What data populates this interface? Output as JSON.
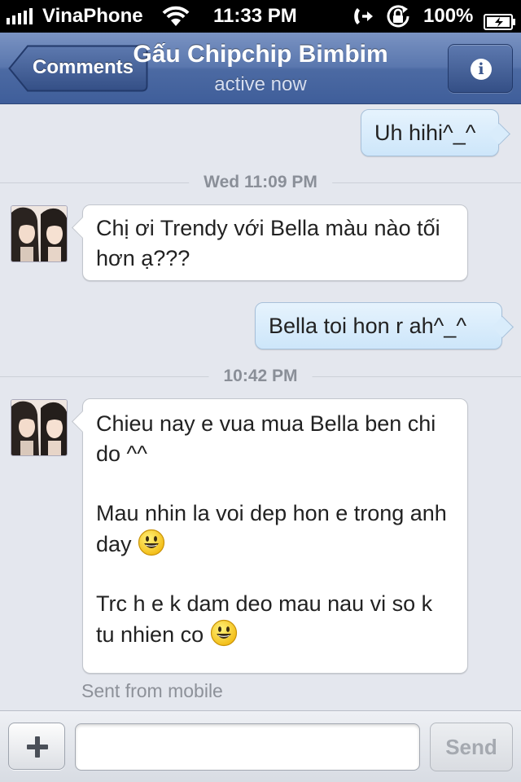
{
  "status_bar": {
    "carrier": "VinaPhone",
    "time": "11:33 PM",
    "battery_percent": "100%",
    "icons": [
      "signal-icon",
      "wifi-icon",
      "call-forwarding-icon",
      "rotation-lock-icon",
      "battery-icon"
    ]
  },
  "nav": {
    "back_label": "Comments",
    "title": "Gấu Chipchip Bimbim",
    "subtitle": "active now",
    "info_icon": "info-icon",
    "info_glyph": "i",
    "colors": {
      "bar": "#4c6aa3",
      "text": "#ffffff"
    }
  },
  "messages": [
    {
      "direction": "outgoing",
      "text": "Uh hihi^_^"
    },
    {
      "type": "timestamp",
      "text": "Wed 11:09 PM"
    },
    {
      "direction": "incoming",
      "lines": [
        "Chị ơi Trendy với Bella màu nào tối hơn ạ???"
      ]
    },
    {
      "direction": "outgoing",
      "text": "Bella toi hon r ah^_^"
    },
    {
      "type": "timestamp",
      "text": "10:42 PM"
    },
    {
      "direction": "incoming",
      "paragraphs": [
        "Chieu nay e vua mua Bella ben chi do ^^",
        "Mau nhin la voi dep hon e trong anh day",
        "Trc h e k dam deo mau nau vi so k tu nhien co"
      ],
      "emoji": "smiley-emoji"
    }
  ],
  "footer_note": "Sent from mobile",
  "composer": {
    "attach_icon": "plus-icon",
    "input_value": "",
    "input_placeholder": "",
    "send_label": "Send"
  }
}
